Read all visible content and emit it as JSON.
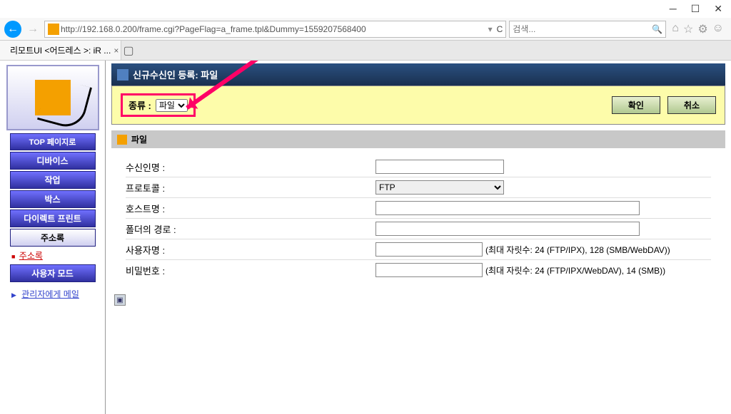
{
  "window": {
    "minimize": "─",
    "maximize": "☐",
    "close": "✕"
  },
  "browser": {
    "url": "http://192.168.0.200/frame.cgi?PageFlag=a_frame.tpl&Dummy=1559207568400",
    "refresh_label": "C",
    "search_placeholder": "검색...",
    "tab_title": "리모트UI <어드레스 >: iR ..."
  },
  "sidebar": {
    "top_btn": "TOP 페이지로",
    "items": [
      "디바이스",
      "작업",
      "박스",
      "다이렉트 프린트",
      "주소록",
      "사용자 모드"
    ],
    "active_index": 4,
    "sublink": "주소록",
    "admin_link": "관리자에게 메일"
  },
  "main": {
    "header_title": "신규수신인 등록: 파일",
    "type_label": "종류 :",
    "type_value": "파일",
    "confirm_btn": "확인",
    "cancel_btn": "취소",
    "section_title": "파일",
    "fields": {
      "recipient": "수신인명 :",
      "protocol": "프로토콜 :",
      "protocol_value": "FTP",
      "host": "호스트명 :",
      "path": "폴더의 경로 :",
      "user": "사용자명 :",
      "user_hint": "(최대 자릿수: 24 (FTP/IPX), 128 (SMB/WebDAV))",
      "password": "비밀번호 :",
      "password_hint": "(최대 자릿수: 24 (FTP/IPX/WebDAV), 14 (SMB))"
    }
  }
}
